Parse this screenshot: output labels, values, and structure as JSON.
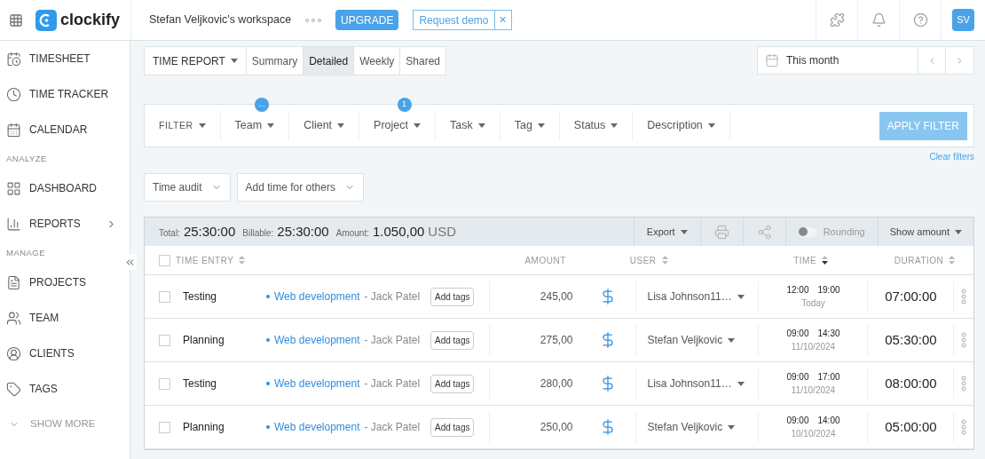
{
  "header": {
    "logo": "clockify",
    "workspace": "Stefan Veljkovic's workspace",
    "upgrade": "UPGRADE",
    "request_demo": "Request demo",
    "close": "×",
    "avatar": "SV"
  },
  "sidebar": {
    "sections": [
      {
        "items": [
          {
            "label": "TIMESHEET",
            "kind": "timesheet",
            "expandable": false
          },
          {
            "label": "TIME TRACKER",
            "kind": "clock",
            "expandable": false
          },
          {
            "label": "CALENDAR",
            "kind": "calendar",
            "expandable": false
          }
        ]
      },
      {
        "title": "ANALYZE",
        "items": [
          {
            "label": "DASHBOARD",
            "kind": "dashboard",
            "expandable": false
          },
          {
            "label": "REPORTS",
            "kind": "reports",
            "expandable": true
          }
        ]
      },
      {
        "title": "MANAGE",
        "items": [
          {
            "label": "PROJECTS",
            "kind": "projects",
            "expandable": false
          },
          {
            "label": "TEAM",
            "kind": "team",
            "expandable": false
          },
          {
            "label": "CLIENTS",
            "kind": "clients",
            "expandable": false
          },
          {
            "label": "TAGS",
            "kind": "tags",
            "expandable": false
          }
        ]
      }
    ],
    "show_more": "SHOW MORE"
  },
  "report_tabs": {
    "dropdown": "TIME REPORT",
    "tabs": [
      {
        "label": "Summary",
        "selected": false
      },
      {
        "label": "Detailed",
        "selected": true
      },
      {
        "label": "Weekly",
        "selected": false
      },
      {
        "label": "Shared",
        "selected": false
      }
    ]
  },
  "date_range": "This month",
  "filters": {
    "label": "FILTER",
    "items": [
      {
        "label": "Team",
        "badge": "..."
      },
      {
        "label": "Client"
      },
      {
        "label": "Project",
        "badge": "1"
      },
      {
        "label": "Task"
      },
      {
        "label": "Tag"
      },
      {
        "label": "Status"
      },
      {
        "label": "Description"
      }
    ],
    "apply": "APPLY FILTER",
    "clear": "Clear filters"
  },
  "actions": [
    "Time audit",
    "Add time for others"
  ],
  "totals": {
    "total_label": "Total:",
    "total": "25:30:00",
    "billable_label": "Billable:",
    "billable": "25:30:00",
    "amount_label": "Amount:",
    "amount": "1.050,00",
    "currency": "USD",
    "export": "Export",
    "rounding": {
      "label": "Rounding",
      "on": false
    },
    "show_amount": "Show amount"
  },
  "table": {
    "select_all_checked": false,
    "columns": [
      {
        "label": "TIME ENTRY",
        "sortable": true,
        "sorted": false
      },
      {
        "label": "AMOUNT",
        "sortable": false
      },
      {
        "label": "USER",
        "sortable": true,
        "sorted": false
      },
      {
        "label": "TIME",
        "sortable": true,
        "sorted": true
      },
      {
        "label": "DURATION",
        "sortable": true,
        "sorted": false
      }
    ],
    "rows": [
      {
        "checked": false,
        "description": "Testing",
        "project": "Web development",
        "client": "- Jack Patel",
        "tags": "Add tags",
        "amount": "245,00",
        "billable": true,
        "user": "Lisa Johnson11…",
        "start": "12:00",
        "end": "19:00",
        "date": "Today",
        "duration": "07:00:00"
      },
      {
        "checked": false,
        "description": "Planning",
        "project": "Web development",
        "client": "- Jack Patel",
        "tags": "Add tags",
        "amount": "275,00",
        "billable": true,
        "user": "Stefan Veljkovic",
        "start": "09:00",
        "end": "14:30",
        "date": "11/10/2024",
        "duration": "05:30:00"
      },
      {
        "checked": false,
        "description": "Testing",
        "project": "Web development",
        "client": "- Jack Patel",
        "tags": "Add tags",
        "amount": "280,00",
        "billable": true,
        "user": "Lisa Johnson11…",
        "start": "09:00",
        "end": "17:00",
        "date": "11/10/2024",
        "duration": "08:00:00"
      },
      {
        "checked": false,
        "description": "Planning",
        "project": "Web development",
        "client": "- Jack Patel",
        "tags": "Add tags",
        "amount": "250,00",
        "billable": true,
        "user": "Stefan Veljkovic",
        "start": "09:00",
        "end": "14:00",
        "date": "10/10/2024",
        "duration": "05:00:00"
      }
    ]
  }
}
